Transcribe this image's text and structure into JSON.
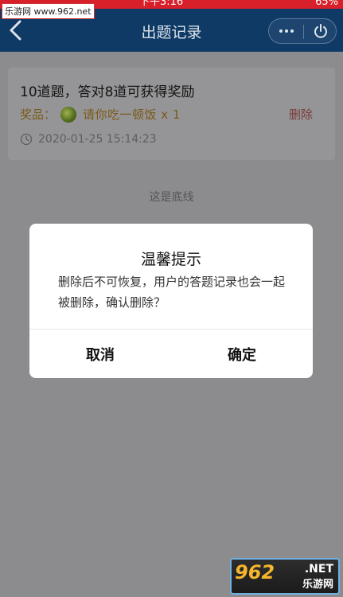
{
  "status_bar": {
    "time": "下午3:16",
    "battery": "65%"
  },
  "watermark_top": "乐游网 www.962.net",
  "navbar": {
    "title": "出题记录"
  },
  "record": {
    "title": "10道题，答对8道可获得奖励",
    "prize_label": "奖品：",
    "prize_name": "请你吃一顿饭 x 1",
    "delete_label": "删除",
    "timestamp": "2020-01-25 15:14:23"
  },
  "bottom_line": "这是底线",
  "dialog": {
    "title": "温馨提示",
    "message": "删除后不可恢复，用户的答题记录也会一起被删除，确认删除？",
    "cancel_label": "取消",
    "confirm_label": "确定"
  },
  "watermark_logo": {
    "number": "962",
    "domain": ".NET",
    "name": "乐游网"
  }
}
